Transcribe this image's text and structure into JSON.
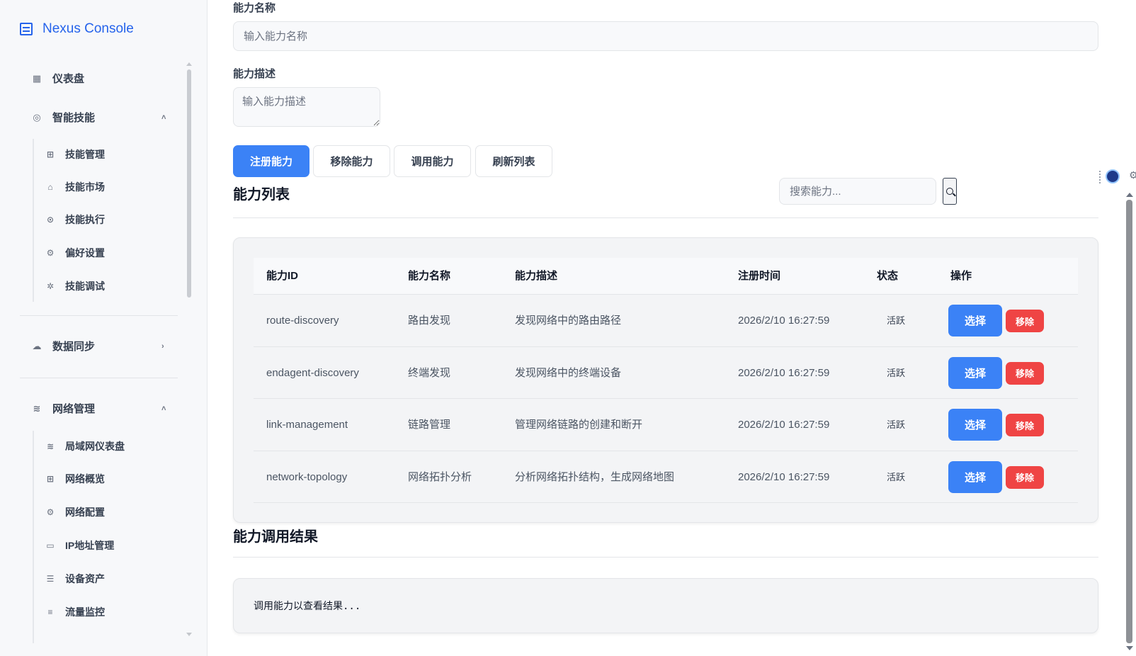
{
  "brand": {
    "title": "Nexus Console",
    "icon": "console-icon"
  },
  "sidebar": {
    "items": [
      {
        "label": "仪表盘",
        "icon": "dashboard-grid-icon"
      },
      {
        "label": "智能技能",
        "icon": "camera-icon",
        "chevron": "˄"
      },
      {
        "label": "数据同步",
        "icon": "cloud-icon",
        "chevron": "›"
      },
      {
        "label": "网络管理",
        "icon": "wifi-icon",
        "chevron": "˄"
      }
    ],
    "skills_sub": [
      {
        "label": "技能管理",
        "icon": "grid-icon"
      },
      {
        "label": "技能市场",
        "icon": "store-icon"
      },
      {
        "label": "技能执行",
        "icon": "play-icon"
      },
      {
        "label": "偏好设置",
        "icon": "gear-icon"
      },
      {
        "label": "技能调试",
        "icon": "bug-icon"
      }
    ],
    "network_sub": [
      {
        "label": "局域网仪表盘",
        "icon": "wifi-icon"
      },
      {
        "label": "网络概览",
        "icon": "grid-icon"
      },
      {
        "label": "网络配置",
        "icon": "gear-icon"
      },
      {
        "label": "IP地址管理",
        "icon": "monitor-icon"
      },
      {
        "label": "设备资产",
        "icon": "list-icon"
      },
      {
        "label": "流量监控",
        "icon": "sliders-icon"
      }
    ]
  },
  "form": {
    "name_label": "能力名称",
    "name_placeholder": "输入能力名称",
    "desc_label": "能力描述",
    "desc_placeholder": "输入能力描述"
  },
  "actions": {
    "register": "注册能力",
    "remove": "移除能力",
    "invoke": "调用能力",
    "refresh": "刷新列表"
  },
  "list": {
    "title": "能力列表",
    "search_placeholder": "搜索能力...",
    "columns": [
      "能力ID",
      "能力名称",
      "能力描述",
      "注册时间",
      "状态",
      "操作"
    ],
    "rows": [
      {
        "id": "route-discovery",
        "name": "路由发现",
        "desc": "发现网络中的路由路径",
        "time": "2026/2/10 16:27:59",
        "status": "活跃",
        "select": "选择",
        "remove": "移除"
      },
      {
        "id": "endagent-discovery",
        "name": "终端发现",
        "desc": "发现网络中的终端设备",
        "time": "2026/2/10 16:27:59",
        "status": "活跃",
        "select": "选择",
        "remove": "移除"
      },
      {
        "id": "link-management",
        "name": "链路管理",
        "desc": "管理网络链路的创建和断开",
        "time": "2026/2/10 16:27:59",
        "status": "活跃",
        "select": "选择",
        "remove": "移除"
      },
      {
        "id": "network-topology",
        "name": "网络拓扑分析",
        "desc": "分析网络拓扑结构，生成网络地图",
        "time": "2026/2/10 16:27:59",
        "status": "活跃",
        "select": "选择",
        "remove": "移除"
      }
    ]
  },
  "result": {
    "title": "能力调用结果",
    "text": "调用能力以查看结果..."
  },
  "colors": {
    "accent": "#3b82f6",
    "danger": "#ef4444",
    "brand": "#2563eb"
  }
}
